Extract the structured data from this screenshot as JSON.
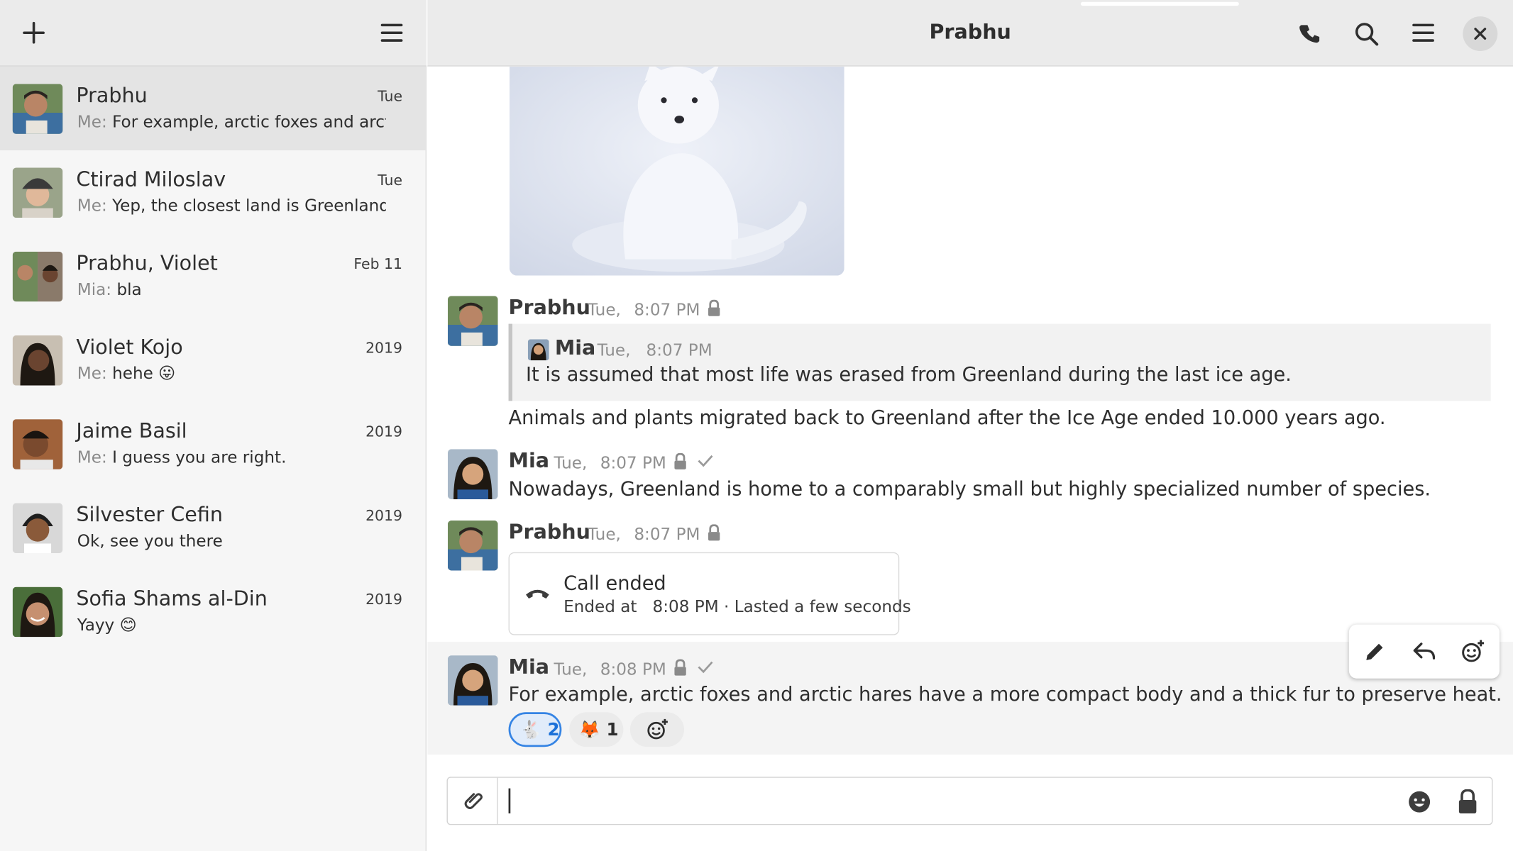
{
  "sidebar": {
    "rooms": [
      {
        "name": "Prabhu",
        "date": "Tue",
        "sender": "Me:",
        "text": "For example, arctic foxes and arcti…",
        "selected": true
      },
      {
        "name": "Ctirad Miloslav",
        "date": "Tue",
        "sender": "Me:",
        "text": "Yep, the closest land is Greenland. …"
      },
      {
        "name": "Prabhu, Violet",
        "date": "Feb 11",
        "sender": "Mia:",
        "text": "bla"
      },
      {
        "name": "Violet Kojo",
        "date": "2019",
        "sender": "Me:",
        "text": "hehe 😛"
      },
      {
        "name": "Jaime Basil",
        "date": "2019",
        "sender": "Me:",
        "text": "I guess you are right."
      },
      {
        "name": "Silvester Cefin",
        "date": "2019",
        "sender": "",
        "text": "Ok, see you there"
      },
      {
        "name": "Sofia Shams al-Din",
        "date": "2019",
        "sender": "",
        "text": "Yayy 😊"
      }
    ]
  },
  "header": {
    "title": "Prabhu"
  },
  "timeline": {
    "msg1": {
      "sender": "Prabhu",
      "day": "Tue,",
      "time": "8:07 PM",
      "quote": {
        "sender": "Mia",
        "day": "Tue,",
        "time": "8:07 PM",
        "text": "It is assumed that most life was erased from Greenland during the last ice age."
      },
      "text": "Animals and plants migrated back to Greenland after the Ice Age ended 10.000 years ago."
    },
    "msg2": {
      "sender": "Mia",
      "day": "Tue,",
      "time": "8:07 PM",
      "text": "Nowadays, Greenland is home to a comparably small but highly specialized number of species."
    },
    "msg3": {
      "sender": "Prabhu",
      "day": "Tue,",
      "time": "8:07 PM",
      "call_title": "Call ended",
      "call_prefix": "Ended at",
      "call_time": "8:08 PM",
      "call_suffix": "· Lasted a few seconds"
    },
    "msg4": {
      "sender": "Mia",
      "day": "Tue,",
      "time": "8:08 PM",
      "text": "For example, arctic foxes and arctic hares have a more compact body and a thick fur to preserve heat.",
      "reactions": [
        {
          "emoji": "🐇",
          "count": "2",
          "mine": true
        },
        {
          "emoji": "🦊",
          "count": "1",
          "mine": false
        }
      ]
    }
  },
  "composer": {
    "placeholder": ""
  },
  "colors": {
    "accent": "#3584e4",
    "header_bg": "#ebebeb",
    "sidebar_bg": "#f6f6f6"
  }
}
